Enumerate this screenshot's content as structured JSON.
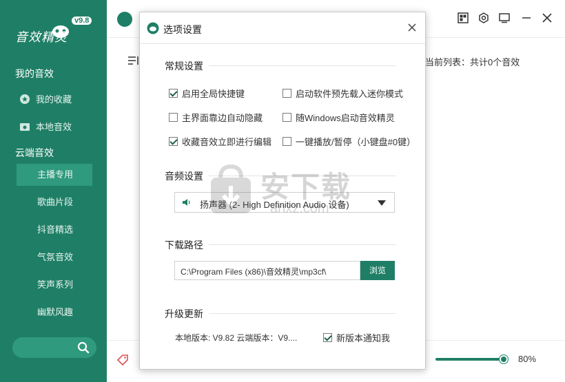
{
  "app": {
    "logo_text": "音效精灵",
    "version": "v9.8"
  },
  "sidebar": {
    "my_section": "我的音效",
    "favorites": "我的收藏",
    "local": "本地音效",
    "cloud_section": "云端音效",
    "sub_items": [
      {
        "label": "主播专用",
        "active": true
      },
      {
        "label": "歌曲片段",
        "active": false
      },
      {
        "label": "抖音精选",
        "active": false
      },
      {
        "label": "气氛音效",
        "active": false
      },
      {
        "label": "笑声系列",
        "active": false
      },
      {
        "label": "幽默风趣",
        "active": false
      }
    ]
  },
  "main": {
    "list_status": "当前列表：共计0个音效",
    "volume_label": "80%",
    "volume_level": 0.8
  },
  "dialog": {
    "title": "选项设置",
    "general": {
      "title": "常规设置",
      "options": [
        {
          "label": "启用全局快捷键",
          "checked": true
        },
        {
          "label": "启动软件预先载入迷你模式",
          "checked": false
        },
        {
          "label": "主界面靠边自动隐藏",
          "checked": false
        },
        {
          "label": "随Windows启动音效精灵",
          "checked": false
        },
        {
          "label": "收藏音效立即进行编辑",
          "checked": true
        },
        {
          "label": "一键播放/暂停（小键盘#0键）",
          "checked": false
        }
      ]
    },
    "audio": {
      "title": "音频设置",
      "device": "扬声器 (2- High Definition Audio 设备)"
    },
    "download": {
      "title": "下载路径",
      "path": "C:\\Program Files (x86)\\音效精灵\\mp3cf\\",
      "browse": "浏览"
    },
    "update": {
      "title": "升级更新",
      "version_text": "本地版本: V9.82  云端版本：V9....",
      "notify_label": "新版本通知我",
      "notify_checked": true
    }
  },
  "watermark": {
    "text": "安下载",
    "sub": "anxz.com"
  },
  "colors": {
    "brand": "#1f7f66",
    "brand_light": "#2f9a7d"
  }
}
